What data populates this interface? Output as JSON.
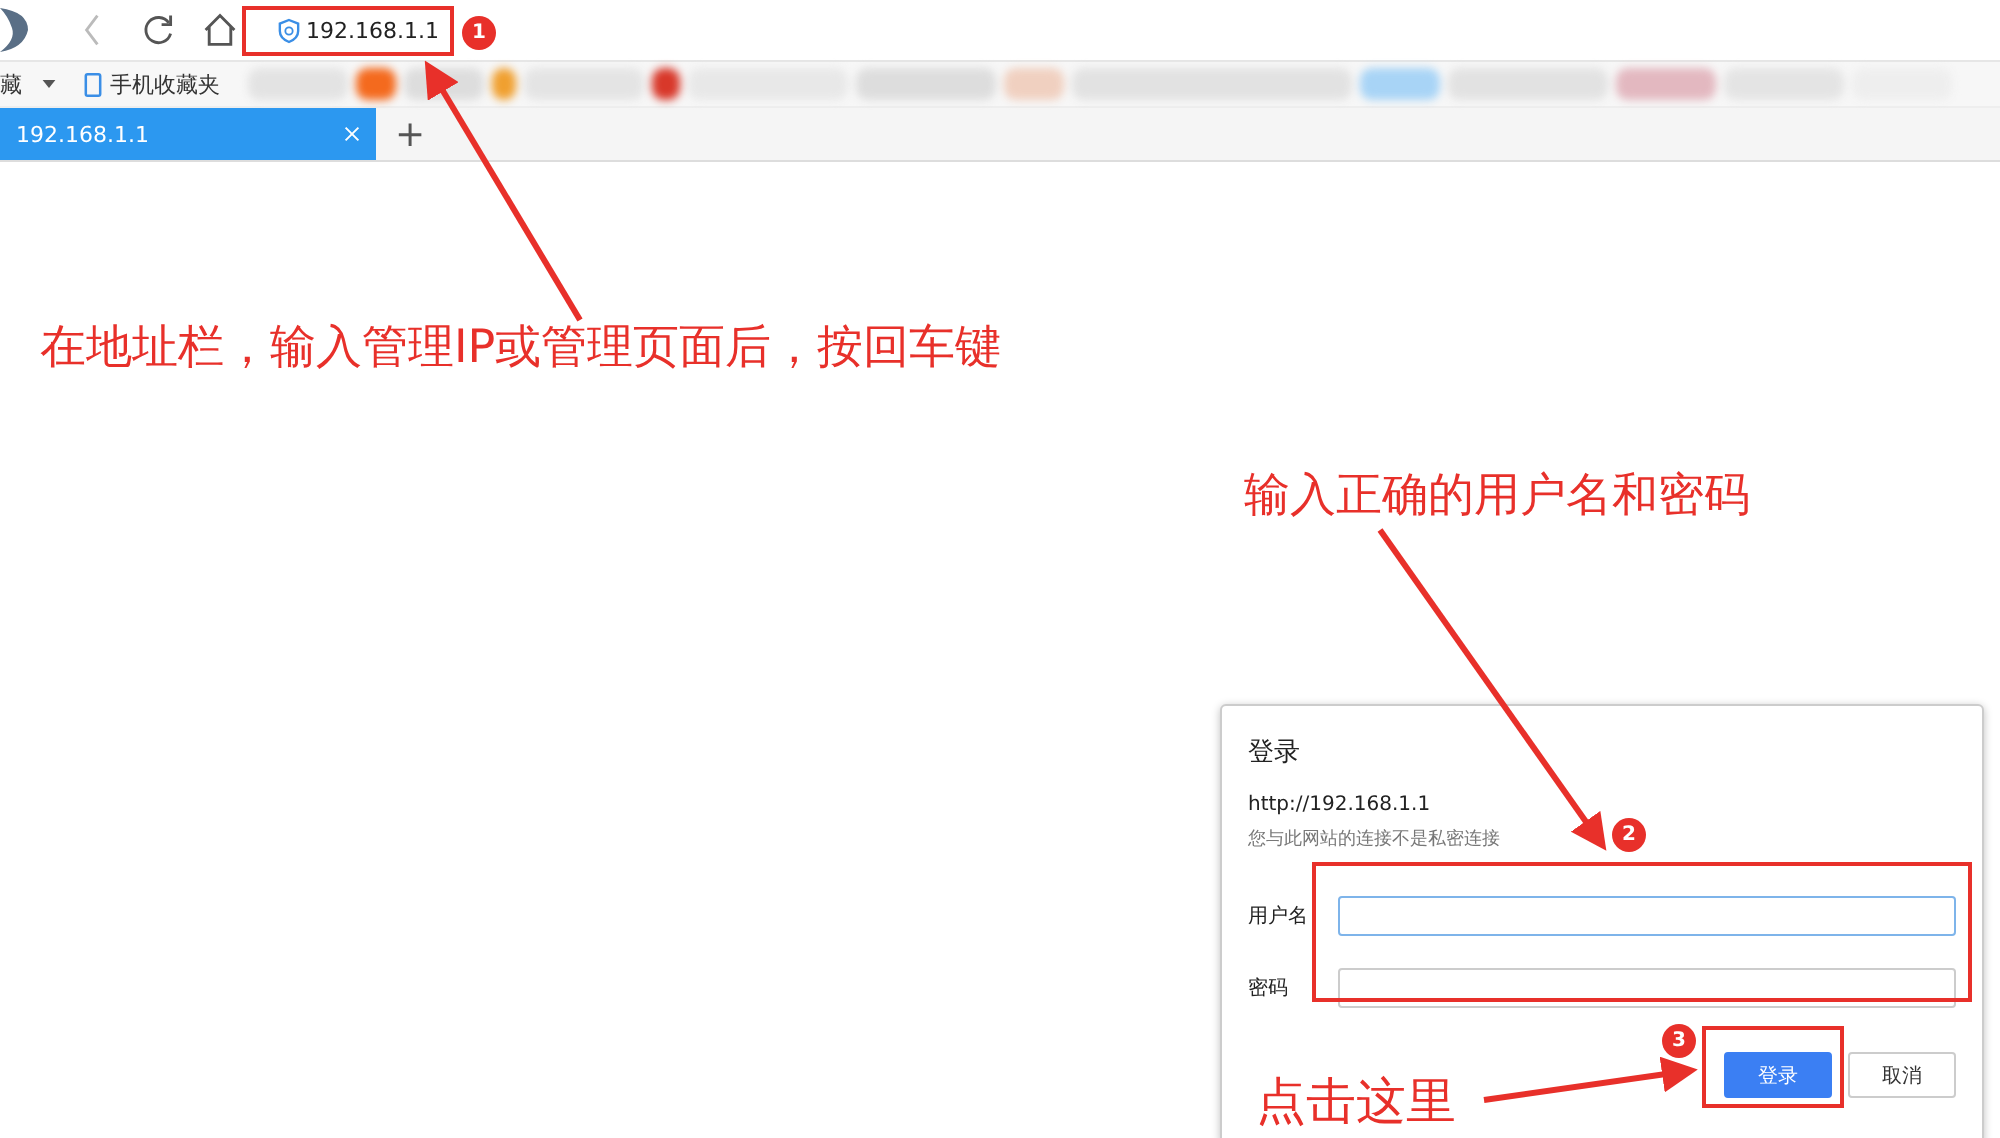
{
  "address_bar": {
    "url": "192.168.1.1"
  },
  "bookmarks": [
    {
      "label": "藏",
      "kind": "folder"
    },
    {
      "label": "手机收藏夹",
      "kind": "mobile"
    }
  ],
  "tabs": [
    {
      "title": "192.168.1.1",
      "selected": true
    }
  ],
  "new_tab": "+",
  "annotations": [
    {
      "text": "在地址栏，输入管理IP或管理页面后，按回车键",
      "kind": "address"
    },
    {
      "text": "输入正确的用户名和密码",
      "kind": "credentials"
    },
    {
      "text": "点击这里",
      "kind": "button"
    }
  ],
  "markers": [
    "1",
    "2",
    "3"
  ],
  "dialog": {
    "title": "登录",
    "url": "http://192.168.1.1",
    "warning": "您与此网站的连接不是私密连接",
    "fields": [
      {
        "label": "用户名",
        "focused": true
      },
      {
        "label": "密码",
        "focused": false
      }
    ],
    "buttons": [
      {
        "label": "登录",
        "primary": true
      },
      {
        "label": "取消",
        "primary": false
      }
    ]
  }
}
